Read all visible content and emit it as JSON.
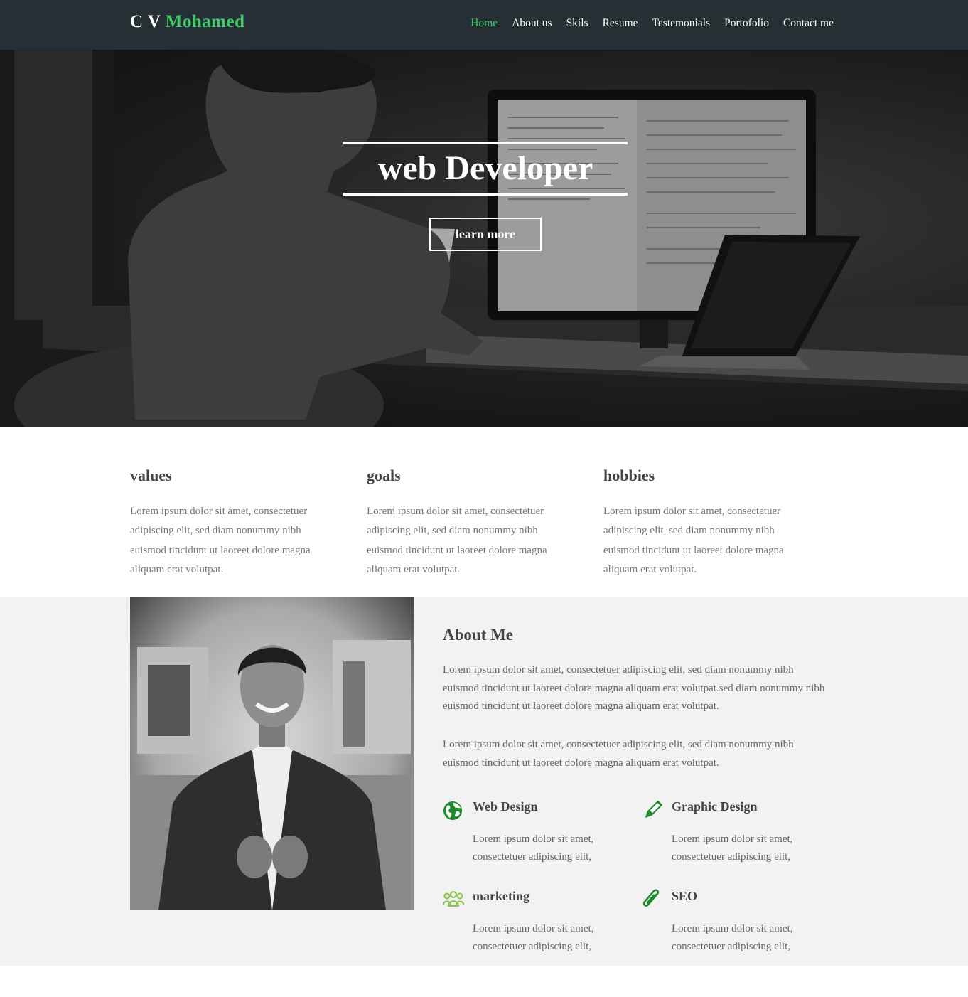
{
  "brand": {
    "prefix": "C V",
    "name": "Mohamed"
  },
  "nav": [
    {
      "label": "Home",
      "active": true
    },
    {
      "label": "About us"
    },
    {
      "label": "Skils"
    },
    {
      "label": "Resume"
    },
    {
      "label": "Testemonials"
    },
    {
      "label": "Portofolio"
    },
    {
      "label": "Contact me"
    }
  ],
  "hero": {
    "title": "web Developer",
    "button": "learn more"
  },
  "features": [
    {
      "title": "values",
      "text": "Lorem ipsum dolor sit amet, consectetuer adipiscing elit, sed diam nonummy nibh euismod tincidunt ut laoreet dolore magna aliquam erat volutpat."
    },
    {
      "title": "goals",
      "text": "Lorem ipsum dolor sit amet, consectetuer adipiscing elit, sed diam nonummy nibh euismod tincidunt ut laoreet dolore magna aliquam erat volutpat."
    },
    {
      "title": "hobbies",
      "text": "Lorem ipsum dolor sit amet, consectetuer adipiscing elit, sed diam nonummy nibh euismod tincidunt ut laoreet dolore magna aliquam erat volutpat."
    }
  ],
  "about": {
    "title": "About Me",
    "p1": "Lorem ipsum dolor sit amet, consectetuer adipiscing elit, sed diam nonummy nibh euismod tincidunt ut laoreet dolore magna aliquam erat volutpat.sed diam nonummy nibh euismod tincidunt ut laoreet dolore magna aliquam erat volutpat.",
    "p2": "Lorem ipsum dolor sit amet, consectetuer adipiscing elit, sed diam nonummy nibh euismod tincidunt ut laoreet dolore magna aliquam erat volutpat.",
    "services": [
      {
        "title": "Web Design",
        "text": "Lorem ipsum dolor sit amet, consectetuer adipiscing elit,",
        "icon": "globe-icon"
      },
      {
        "title": "Graphic Design",
        "text": "Lorem ipsum dolor sit amet, consectetuer adipiscing elit,",
        "icon": "pencil-icon"
      },
      {
        "title": "marketing",
        "text": "Lorem ipsum dolor sit amet, consectetuer adipiscing elit,",
        "icon": "users-icon"
      },
      {
        "title": "SEO",
        "text": "Lorem ipsum dolor sit amet, consectetuer adipiscing elit,",
        "icon": "paperclip-icon"
      }
    ]
  },
  "colors": {
    "accent": "#3ec96b",
    "navbar": "#263034",
    "icon_green": "#1e8a2e",
    "icon_lightgreen": "#8bc34a"
  }
}
